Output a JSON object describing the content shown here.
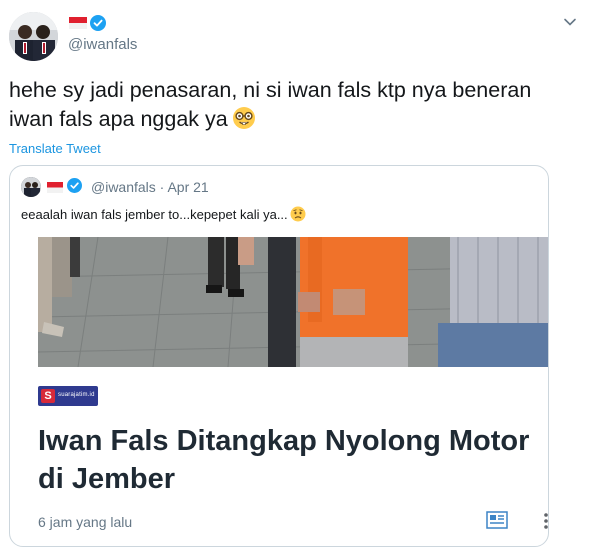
{
  "header": {
    "handle": "@iwanfals"
  },
  "tweet": {
    "text": "hehe sy jadi penasaran, ni si iwan fals ktp nya beneran iwan fals apa nggak ya",
    "emoji": "nerd-face-emoji",
    "translate_label": "Translate Tweet"
  },
  "quoted": {
    "handle": "@iwanfals",
    "separator": " · ",
    "date": "Apr 21",
    "text": "eeaalah iwan fals jember to...kepepet kali ya...",
    "emoji": "worried-face-emoji",
    "card": {
      "source_initial": "S",
      "source_name": "suarajatim.id",
      "headline": "Iwan Fals Ditangkap Nyolong Motor di Jember",
      "time_ago": "6 jam yang lalu"
    }
  },
  "colors": {
    "link": "#1b95e0",
    "verified": "#1da1f2",
    "secondary_text": "#657786",
    "border": "#ccd6dd"
  }
}
